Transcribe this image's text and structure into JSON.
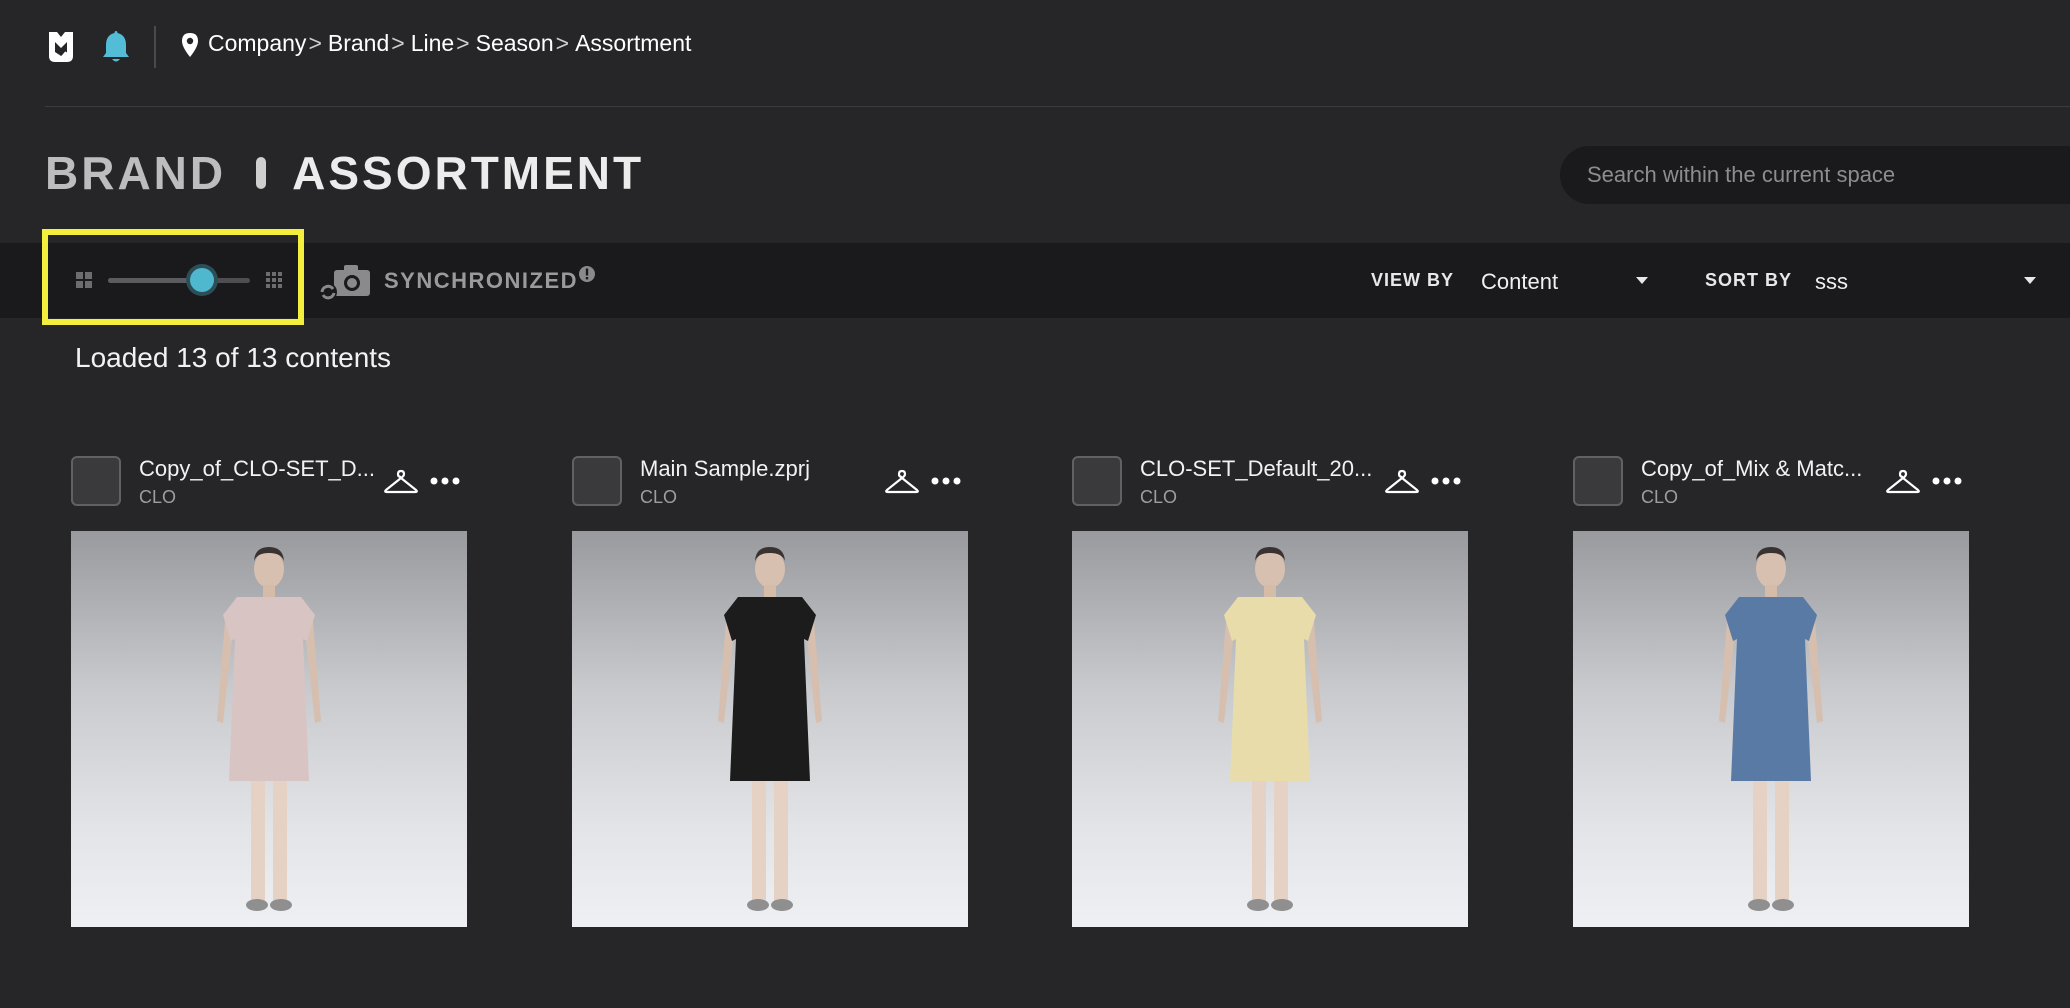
{
  "breadcrumb": {
    "items": [
      "Company",
      "Brand",
      "Line",
      "Season",
      "Assortment"
    ],
    "separator": ">"
  },
  "header": {
    "brand": "BRAND",
    "section": "ASSORTMENT"
  },
  "search": {
    "placeholder": "Search within the current space"
  },
  "toolbar": {
    "thumbnail_size_level": 0.66,
    "sync_label": "SYNCHRONIZED",
    "view_by_label": "VIEW BY",
    "view_by_value": "Content",
    "sort_by_label": "SORT BY",
    "sort_by_value": "sss"
  },
  "status": {
    "loaded_text": "Loaded 13 of 13 contents"
  },
  "colors": {
    "accent": "#4fb8cf",
    "highlight": "#f4ee3c",
    "background": "#262628",
    "toolbar": "#1a1a1c"
  },
  "cards": [
    {
      "name": "Copy_of_CLO-SET_D...",
      "owner": "CLO",
      "garment_color": "#d9c4c4"
    },
    {
      "name": "Main Sample.zprj",
      "owner": "CLO",
      "garment_color": "#1c1c1c"
    },
    {
      "name": "CLO-SET_Default_20...",
      "owner": "CLO",
      "garment_color": "#e8dcaa"
    },
    {
      "name": "Copy_of_Mix & Matc...",
      "owner": "CLO",
      "garment_color": "#5a7aa6"
    }
  ]
}
